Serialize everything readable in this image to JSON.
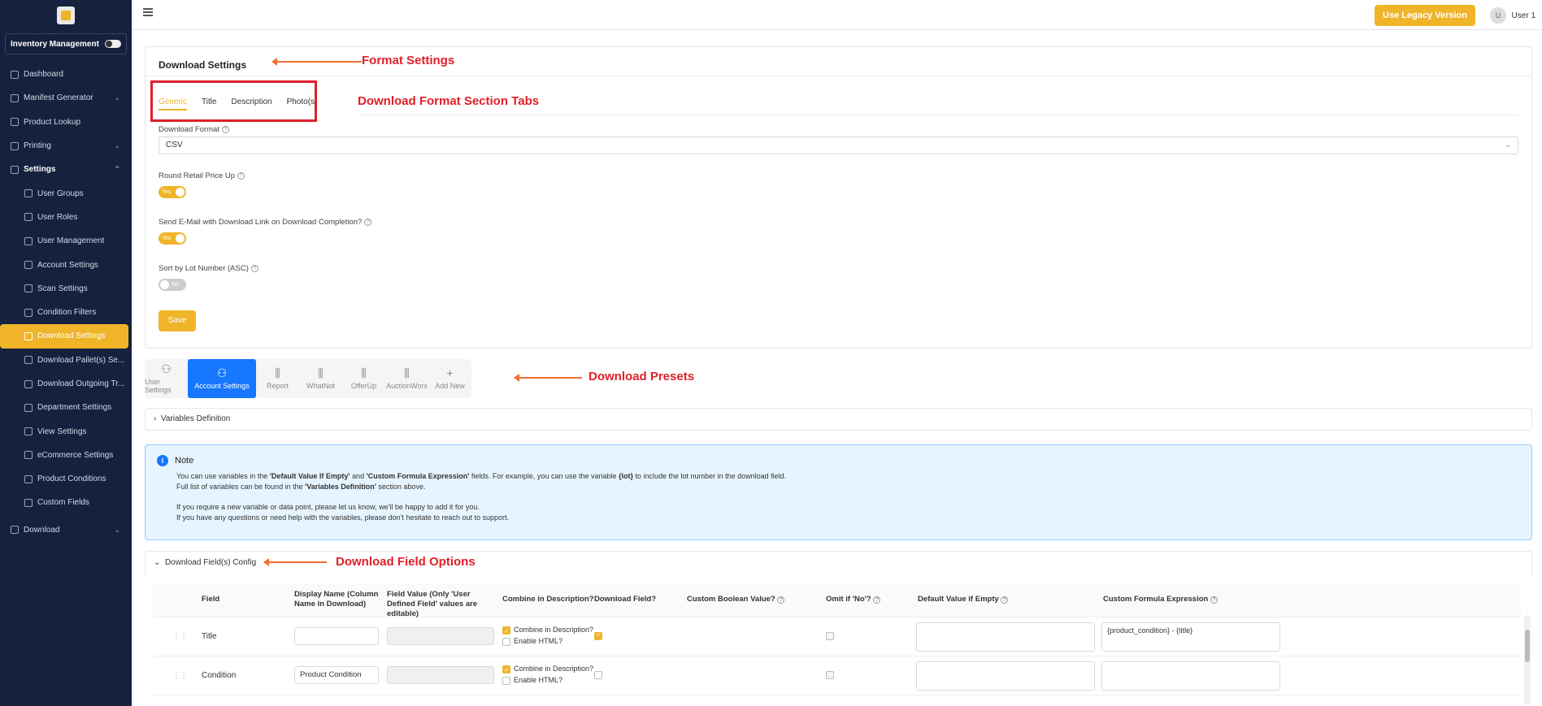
{
  "sidebar": {
    "mode_label": "Inventory Management",
    "items": [
      {
        "label": "Dashboard",
        "icon": "dashboard-icon"
      },
      {
        "label": "Manifest Generator",
        "icon": "manifest-icon",
        "chevron": "⌄"
      },
      {
        "label": "Product Lookup",
        "icon": "document-icon"
      },
      {
        "label": "Printing",
        "icon": "printer-icon",
        "chevron": "⌄"
      },
      {
        "label": "Settings",
        "icon": "settings-icon",
        "chevron": "⌃"
      },
      {
        "label": "User Groups",
        "icon": "grid-icon"
      },
      {
        "label": "User Roles",
        "icon": "grid-icon"
      },
      {
        "label": "User Management",
        "icon": "grid-icon"
      },
      {
        "label": "Account Settings",
        "icon": "gear-icon"
      },
      {
        "label": "Scan Settings",
        "icon": "gear-icon"
      },
      {
        "label": "Condition Filters",
        "icon": "document-icon"
      },
      {
        "label": "Download Settings",
        "icon": "download-icon"
      },
      {
        "label": "Download Pallet(s) Se...",
        "icon": "download-icon"
      },
      {
        "label": "Download Outgoing Tr...",
        "icon": "download-icon"
      },
      {
        "label": "Department Settings",
        "icon": "edit-icon"
      },
      {
        "label": "View Settings",
        "icon": "edit-icon"
      },
      {
        "label": "eCommerce Settings",
        "icon": "edit-icon"
      },
      {
        "label": "Product Conditions",
        "icon": "gear-icon"
      },
      {
        "label": "Custom Fields",
        "icon": "gear-icon"
      },
      {
        "label": "Download",
        "icon": "document-icon",
        "chevron": "⌄"
      }
    ]
  },
  "topbar": {
    "legacy_button": "Use Legacy Version",
    "avatar_initial": "U",
    "user_name": "User 1"
  },
  "settings_card": {
    "title": "Download Settings",
    "tabs": [
      "Generic",
      "Title",
      "Description",
      "Photo(s)"
    ],
    "download_format_label": "Download Format",
    "download_format_value": "CSV",
    "round_label": "Round Retail Price Up",
    "round_value": "Yes",
    "email_label": "Send E-Mail with Download Link on Download Completion?",
    "email_value": "Yes",
    "sort_label": "Sort by Lot Number (ASC)",
    "sort_value": "No",
    "save_label": "Save"
  },
  "annotations": {
    "format_settings": "Format Settings",
    "section_tabs": "Download Format Section Tabs",
    "presets": "Download Presets",
    "field_options": "Download Field Options"
  },
  "presets": [
    {
      "label": "User Settings",
      "glyph": "⚇"
    },
    {
      "label": "Account Settings",
      "glyph": "⚇"
    },
    {
      "label": "Report",
      "glyph": "⫼"
    },
    {
      "label": "WhatNot",
      "glyph": "⫼"
    },
    {
      "label": "OfferUp",
      "glyph": "⫼"
    },
    {
      "label": "AuctionWorx",
      "glyph": "⫼"
    },
    {
      "label": "Add New",
      "glyph": "+"
    }
  ],
  "variables_definition": "Variables Definition",
  "note": {
    "title": "Note",
    "line1_a": "You can use variables in the ",
    "line1_b": "'Default Value If Empty'",
    "line1_c": " and ",
    "line1_d": "'Custom Formula Expression'",
    "line1_e": " fields. For example, you can use the variable ",
    "line1_f": "{lot}",
    "line1_g": " to include the lot number in the download field.",
    "line2_a": "Full list of variables can be found in the ",
    "line2_b": "'Variables Definition'",
    "line2_c": " section above.",
    "line3": "If you require a new variable or data point, please let us know, we'll be happy to add it for you.",
    "line4": "If you have any questions or need help with the variables, please don't hesitate to reach out to support."
  },
  "config": {
    "title": "Download Field(s) Config",
    "headers": {
      "field": "Field",
      "display_name": "Display Name (Column Name in Download)",
      "field_value": "Field Value (Only 'User Defined Field' values are editable)",
      "combine": "Combine in Description?",
      "download": "Download Field?",
      "custom_bool": "Custom Boolean Value?",
      "omit": "Omit if 'No'?",
      "default": "Default Value if Empty",
      "formula": "Custom Formula Expression"
    },
    "combine_label": "Combine in Description?",
    "html_label": "Enable HTML?",
    "rows": [
      {
        "field": "Title",
        "display": "",
        "formula": "{product_condition} - {title}"
      },
      {
        "field": "Condition",
        "display": "Product Condition",
        "formula": ""
      }
    ]
  }
}
